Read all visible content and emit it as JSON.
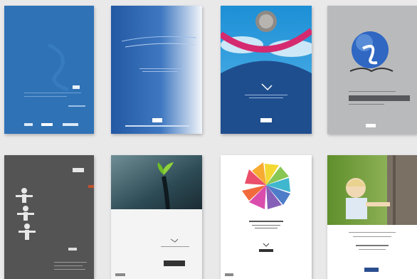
{
  "gallery": {
    "background": "#e9e9ea",
    "rows": [
      {
        "covers": [
          {
            "name": "cover-1",
            "theme": "solid-blue",
            "color": "#2f72b6"
          },
          {
            "name": "cover-2",
            "theme": "blue-gradient",
            "color": "#2e62ad"
          },
          {
            "name": "cover-3",
            "theme": "sky-arc",
            "color": "#1e4f8f"
          },
          {
            "name": "cover-4",
            "theme": "grey-globe-logo",
            "color": "#b9babb"
          }
        ]
      },
      {
        "covers": [
          {
            "name": "cover-5",
            "theme": "dark-grey-figures",
            "color": "#555455"
          },
          {
            "name": "cover-6",
            "theme": "leaf-in-rain",
            "color": "#2b4a52"
          },
          {
            "name": "cover-7",
            "theme": "color-pinwheel",
            "color": "#ffffff"
          },
          {
            "name": "cover-8",
            "theme": "child-with-tree",
            "color": "#7fa24c"
          }
        ]
      }
    ]
  }
}
